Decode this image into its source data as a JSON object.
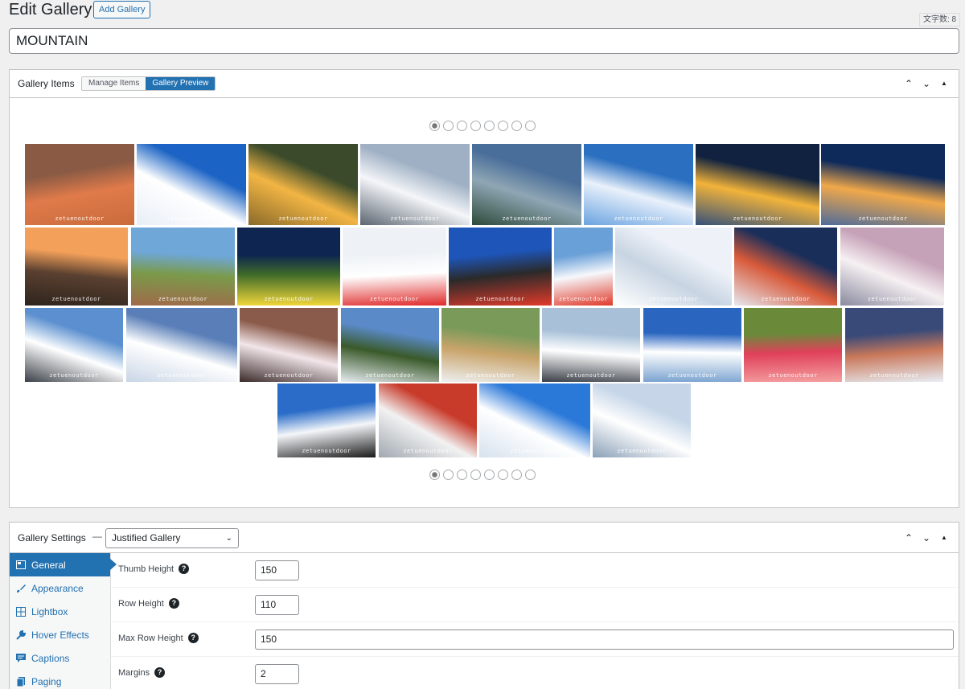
{
  "header": {
    "title": "Edit Gallery",
    "add_button": "Add Gallery",
    "char_count": "文字数: 8",
    "gallery_title": "MOUNTAIN"
  },
  "items_box": {
    "title": "Gallery Items",
    "tabs": [
      "Manage Items",
      "Gallery Preview"
    ],
    "active_tab": "Gallery Preview",
    "pager_pages": 8,
    "current_page": 1,
    "watermark": "zetuenoutdoor",
    "photo_count": 34
  },
  "settings_box": {
    "title": "Gallery Settings",
    "gallery_type": "Justified Gallery",
    "sidebar": [
      {
        "label": "General",
        "icon": "general-icon"
      },
      {
        "label": "Appearance",
        "icon": "brush-icon"
      },
      {
        "label": "Lightbox",
        "icon": "grid-icon"
      },
      {
        "label": "Hover Effects",
        "icon": "wrench-icon"
      },
      {
        "label": "Captions",
        "icon": "caption-icon"
      },
      {
        "label": "Paging",
        "icon": "pages-icon"
      }
    ],
    "active_item": "General",
    "fields": [
      {
        "label": "Thumb Height",
        "value": "150"
      },
      {
        "label": "Row Height",
        "value": "110"
      },
      {
        "label": "Max Row Height",
        "value": "150"
      },
      {
        "label": "Margins",
        "value": "2"
      }
    ]
  },
  "colors": {
    "accent": "#2271b1",
    "page_bg": "#f0f0f1"
  }
}
